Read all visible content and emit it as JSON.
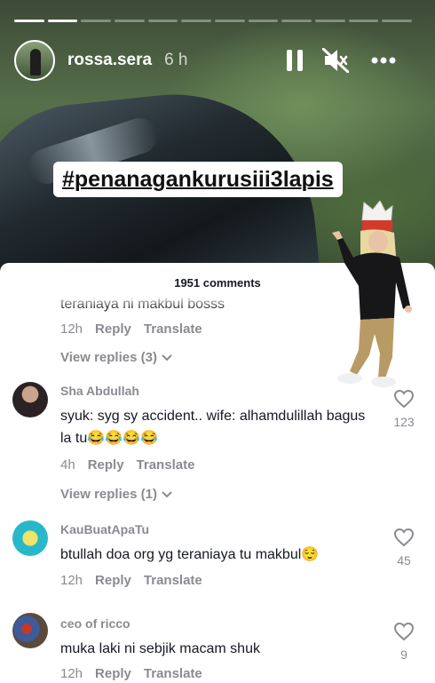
{
  "story": {
    "username": "rossa.sera",
    "time_ago": "6 h",
    "progress": {
      "total_segments": 12,
      "completed_segments": 2
    },
    "hashtag": "#penanagankurusiii3lapis"
  },
  "icons": {
    "pause": "pause-icon",
    "mute": "speaker-muted-icon",
    "more": "more-dots-icon",
    "like": "heart-outline-icon",
    "view_replies_chevron": "chevron-down-icon"
  },
  "colors": {
    "panel_bg": "#ffffff",
    "muted_text": "#8a8b91",
    "primary_text": "#161823"
  },
  "comments_panel": {
    "title": "1951 comments",
    "cut_off_comment": {
      "text": "teraniaya ni makbul bosss",
      "time": "12h",
      "reply_label": "Reply",
      "translate_label": "Translate",
      "view_replies": "View replies (3)"
    },
    "comments": [
      {
        "user": "Sha Abdullah",
        "text": "syuk: syg sy accident.. wife: alhamdulillah bagus la tu😂😂😂😂",
        "time": "4h",
        "reply_label": "Reply",
        "translate_label": "Translate",
        "likes": "123",
        "view_replies": "View replies (1)"
      },
      {
        "user": "KauBuatApaTu",
        "text": "btullah doa org yg teraniaya tu makbul😌",
        "time": "12h",
        "reply_label": "Reply",
        "translate_label": "Translate",
        "likes": "45"
      },
      {
        "user": "ceo of ricco",
        "text": "muka laki ni sebjik macam shuk",
        "time": "12h",
        "reply_label": "Reply",
        "translate_label": "Translate",
        "likes": "9"
      }
    ]
  }
}
